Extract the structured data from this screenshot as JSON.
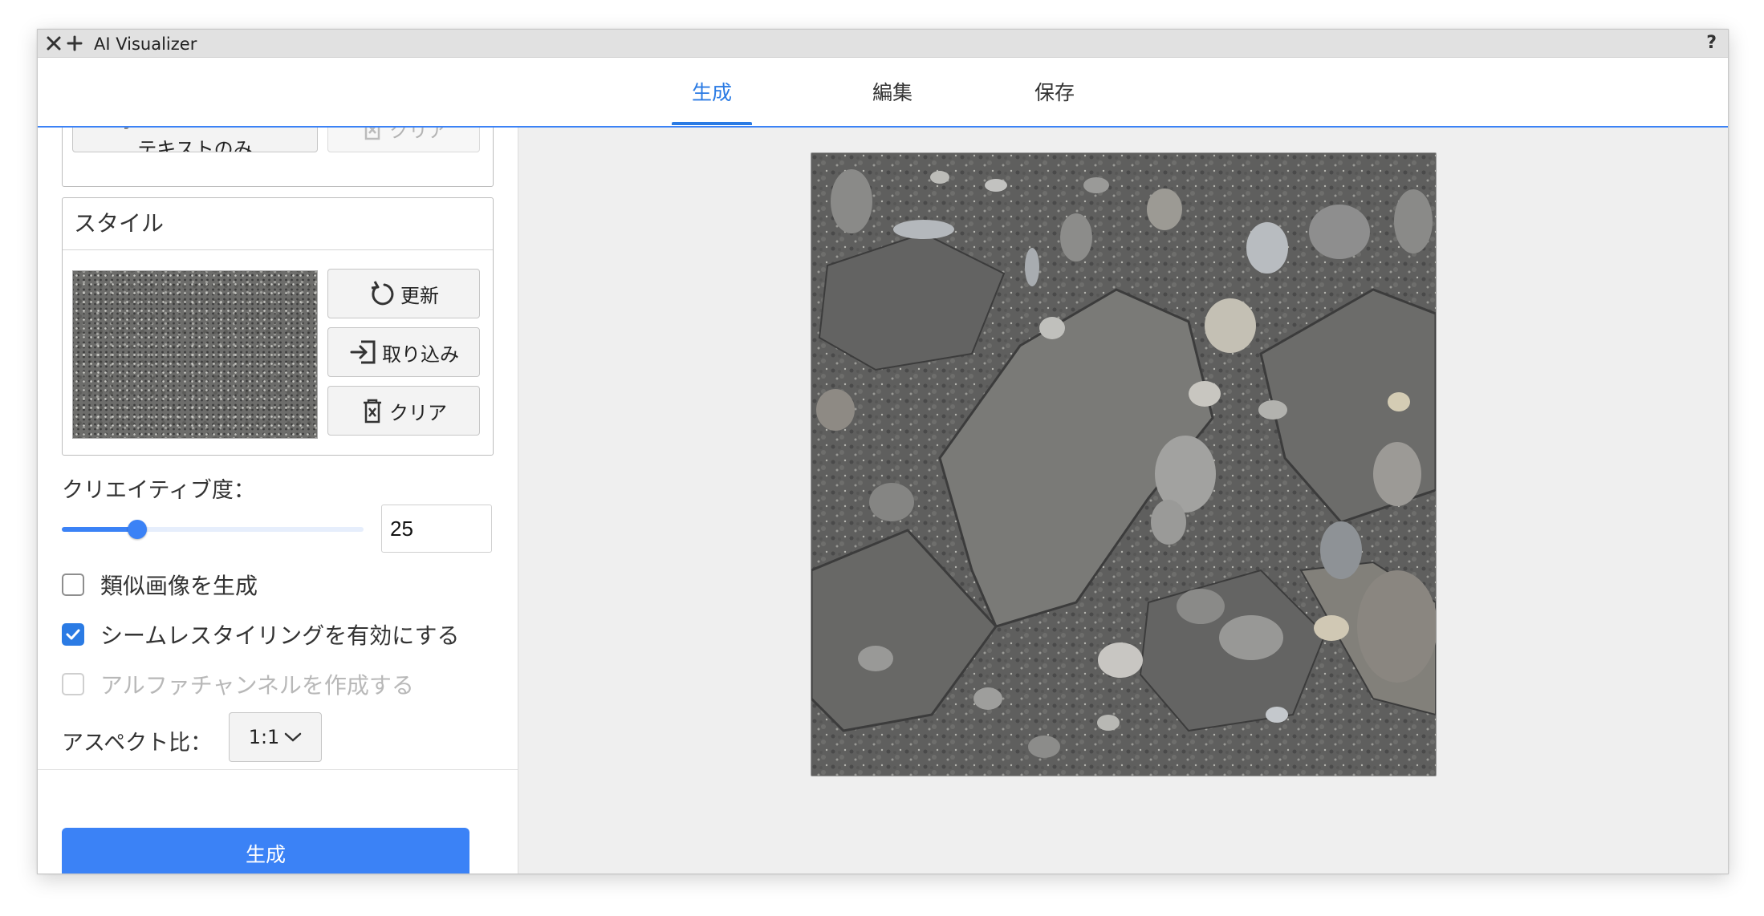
{
  "window": {
    "title": "AI Visualizer",
    "help": "?",
    "close_icon": "close-icon",
    "add_icon": "plus-icon"
  },
  "tabs": [
    {
      "label": "生成",
      "active": true
    },
    {
      "label": "編集",
      "active": false
    },
    {
      "label": "保存",
      "active": false
    }
  ],
  "prompt_section": {
    "text_only_label": "テキストのみ",
    "clear_label": "クリア"
  },
  "style": {
    "title": "スタイル",
    "update_label": "更新",
    "import_label": "取り込み",
    "clear_label": "クリア"
  },
  "creativity": {
    "label": "クリエイティブ度：",
    "value": "25",
    "max": 100
  },
  "options": [
    {
      "label": "類似画像を生成",
      "checked": false,
      "disabled": false
    },
    {
      "label": "シームレスタイリングを有効にする",
      "checked": true,
      "disabled": false
    },
    {
      "label": "アルファチャンネルを作成する",
      "checked": false,
      "disabled": true
    }
  ],
  "aspect": {
    "label": "アスペクト比：",
    "value": "1:1"
  },
  "generate_button": "生成",
  "colors": {
    "accent": "#3b82f6",
    "tab_active": "#2b7be4",
    "panel_bg": "#efefef"
  }
}
